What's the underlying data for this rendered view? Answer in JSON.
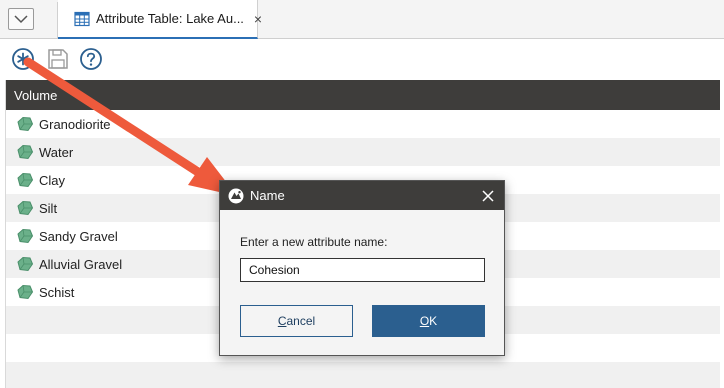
{
  "tab": {
    "label": "Attribute Table: Lake Au...",
    "close": "×"
  },
  "toolbar": {
    "new_attribute_icon": "asterisk-circle-icon",
    "save_icon": "save-icon",
    "help_icon": "help-icon"
  },
  "table": {
    "header": "Volume",
    "rows": [
      "Granodiorite",
      "Water",
      "Clay",
      "Silt",
      "Sandy Gravel",
      "Alluvial Gravel",
      "Schist"
    ],
    "volume_icon_color": "#6bb08a"
  },
  "dialog": {
    "title": "Name",
    "prompt": "Enter a new attribute name:",
    "value": "Cohesion",
    "cancel_label": "Cancel",
    "ok_label": "OK"
  },
  "colors": {
    "header_bg": "#3e3d3b",
    "accent": "#2b5f8f",
    "arrow": "#ee5a3c"
  }
}
